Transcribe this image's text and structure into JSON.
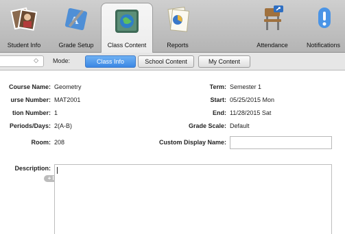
{
  "toolbar": {
    "tabs": [
      {
        "label": "Student Info",
        "icon": "student-photos-icon"
      },
      {
        "label": "Grade Setup",
        "icon": "grade-setup-icon"
      },
      {
        "label": "Class Content",
        "icon": "class-content-icon",
        "active": true
      },
      {
        "label": "Reports",
        "icon": "reports-icon"
      },
      {
        "label": "Attendance",
        "icon": "attendance-chair-icon"
      },
      {
        "label": "Notifications",
        "icon": "notifications-icon"
      }
    ]
  },
  "modebar": {
    "mode_label": "Mode:",
    "stepper_glyph": "◇",
    "segments": [
      {
        "label": "Class Info",
        "active": true
      },
      {
        "label": "School Content"
      },
      {
        "label": "My Content"
      }
    ]
  },
  "fields": {
    "course_name": {
      "label": "Course Name:",
      "value": "Geometry"
    },
    "course_number": {
      "label": "urse Number:",
      "value": "MAT2001"
    },
    "section_number": {
      "label": "tion Number:",
      "value": "1"
    },
    "periods_days": {
      "label": "Periods/Days:",
      "value": "2(A-B)"
    },
    "room": {
      "label": "Room:",
      "value": "208"
    },
    "term": {
      "label": "Term:",
      "value": "Semester 1"
    },
    "start": {
      "label": "Start:",
      "value": "05/25/2015 Mon"
    },
    "end": {
      "label": "End:",
      "value": "11/28/2015 Sat"
    },
    "grade_scale": {
      "label": "Grade Scale:",
      "value": "Default"
    },
    "custom_display_name": {
      "label": "Custom Display Name:",
      "value": ""
    },
    "description": {
      "label": "Description:",
      "value": "",
      "link_label": "+ link"
    }
  },
  "colors": {
    "accent": "#3b87e4",
    "toolbar": "#c2c2c2"
  }
}
